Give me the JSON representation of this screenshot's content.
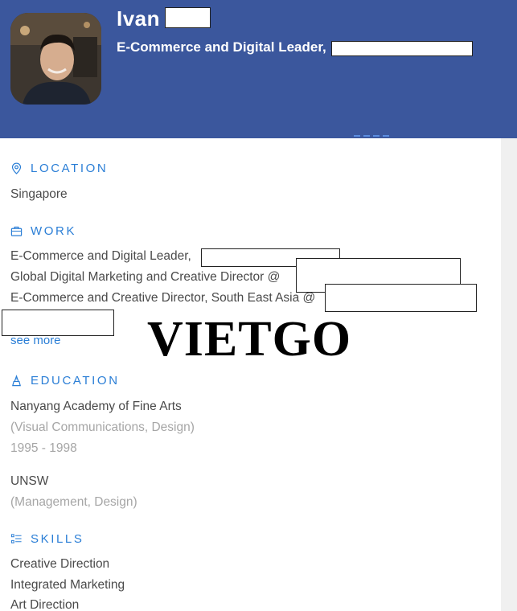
{
  "profile": {
    "name": "Ivan",
    "headline": "E-Commerce and Digital Leader,"
  },
  "location": {
    "title": "LOCATION",
    "icon": "location-pin-icon",
    "value": "Singapore"
  },
  "work": {
    "title": "WORK",
    "icon": "briefcase-icon",
    "items": [
      "E-Commerce and Digital Leader,",
      "Global Digital Marketing and Creative Director @",
      "E-Commerce and Creative Director, South East Asia @"
    ],
    "see_more": "see more"
  },
  "watermark": "VIETGO",
  "education": {
    "title": "EDUCATION",
    "icon": "education-icon",
    "schools": [
      {
        "name": "Nanyang Academy of Fine Arts",
        "field": "(Visual Communications, Design)",
        "years": "1995 - 1998"
      },
      {
        "name": "UNSW",
        "field": "(Management, Design)"
      }
    ]
  },
  "skills": {
    "title": "SKILLS",
    "icon": "skills-list-icon",
    "items": [
      "Creative Direction",
      "Integrated Marketing",
      "Art Direction"
    ]
  },
  "colors": {
    "header_bg": "#3b579d",
    "accent": "#2a7ed6",
    "body_text": "#4a4a4a",
    "muted_text": "#a6a6a6"
  }
}
